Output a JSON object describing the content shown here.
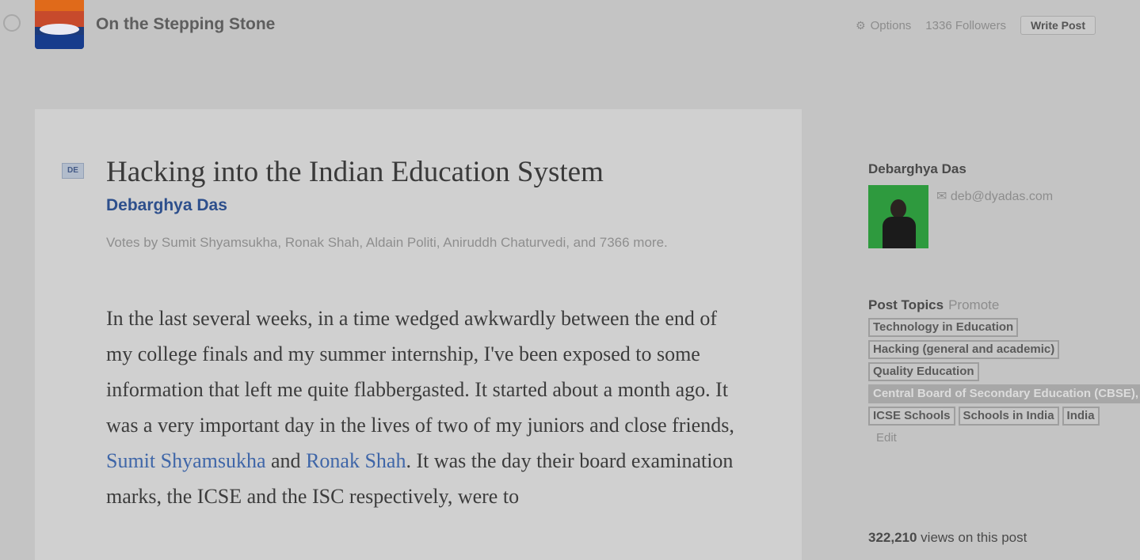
{
  "header": {
    "blog_title": "On the Stepping Stone",
    "options_label": "Options",
    "followers_label": "1336 Followers",
    "write_post_label": "Write Post"
  },
  "post": {
    "doc_icon_label": "DE",
    "title": "Hacking into the Indian Education System",
    "author": "Debarghya Das",
    "votes": "Votes by Sumit Shyamsukha, Ronak Shah, Aldain Politi, Aniruddh Chaturvedi, and 7366 more.",
    "body_part1": "In the last several weeks, in a time wedged awkwardly between the end of my college finals and my summer internship, I've been exposed to some information that left me quite flabbergasted. It started about a month ago. It was a very important day in the lives of two of my juniors and close friends, ",
    "link1": "Sumit Shyamsukha",
    "body_and": " and ",
    "link2": "Ronak Shah",
    "body_part2": ". It was the day their board examination marks, the ICSE and the ISC respectively, were to"
  },
  "sidebar": {
    "author_name": "Debarghya Das",
    "email": "deb@dyadas.com",
    "topics_label": "Post Topics",
    "promote_label": "Promote",
    "tags": [
      {
        "label": "Technology in Education",
        "highlight": false
      },
      {
        "label": "Hacking (general and academic)",
        "highlight": false
      },
      {
        "label": "Quality Education",
        "highlight": false
      },
      {
        "label": "Central Board of Secondary Education (CBSE), India",
        "highlight": true
      },
      {
        "label": "ICSE Schools",
        "highlight": false
      },
      {
        "label": "Schools in India",
        "highlight": false
      },
      {
        "label": "India",
        "highlight": false
      }
    ],
    "edit_label": "Edit",
    "views_count": "322,210",
    "views_suffix": " views on this post"
  },
  "colors": {
    "page_bg": "#c4c4c4",
    "card_bg": "#d0d0d0",
    "link": "#3f66a8",
    "author_link": "#2d4f8c"
  }
}
